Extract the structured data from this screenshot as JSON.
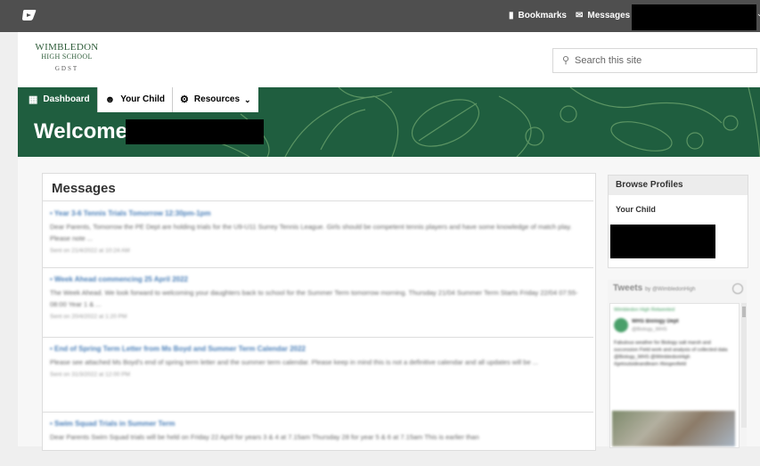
{
  "topbar": {
    "bookmarks_label": "Bookmarks",
    "messages_label": "Messages"
  },
  "school": {
    "logo_line1": "WIMBLEDON",
    "logo_line2": "HIGH SCHOOL",
    "logo_line3": "GDST"
  },
  "search": {
    "placeholder": "Search this site"
  },
  "nav": {
    "items": [
      {
        "label": "Dashboard"
      },
      {
        "label": "Your Child"
      },
      {
        "label": "Resources"
      }
    ]
  },
  "hero": {
    "welcome": "Welcome,"
  },
  "messages": {
    "title": "Messages",
    "items": [
      {
        "title": "• Year 3-6 Tennis Trials Tomorrow 12:30pm-1pm",
        "body": "Dear Parents, Tomorrow the PE Dept are holding trials for the U9-U11 Surrey Tennis League. Girls should be competent tennis players and have some knowledge of match play. Please note ...",
        "date": "Sent on 21/4/2022 at 10:24 AM"
      },
      {
        "title": "• Week Ahead commencing 25 April 2022",
        "body": "The Week Ahead. We look forward to welcoming your daughters back to school for the Summer Term tomorrow morning. Thursday 21/04 Summer Term Starts Friday 22/04 07:55-08:00 Year 1 & ...",
        "date": "Sent on 20/4/2022 at 1:20 PM"
      },
      {
        "title": "• End of Spring Term Letter from Ms Boyd and Summer Term Calendar 2022",
        "body": "Please see attached Ms Boyd's end of spring term letter and the summer term calendar. Please keep in mind this is not a definitive calendar and all updates will be ...",
        "date": "Sent on 31/3/2022 at 12:00 PM"
      },
      {
        "title": "• Swim Squad Trials in Summer Term",
        "body": "Dear Parents Swim Squad trials will be held on Friday 22 April for years 3 & 4 at 7.15am Thursday 28 for year 5 & 6 at 7.15am This is earlier than",
        "date": ""
      }
    ]
  },
  "browse_profiles": {
    "title": "Browse Profiles",
    "your_child": "Your Child"
  },
  "tweets": {
    "title": "Tweets",
    "by": "by @WimbledonHigh",
    "account_line": "Wimbledon High Retweeted",
    "author": "WHS Biology Dept",
    "handle": "@Biology_WHS",
    "text": "Fabulous weather for Biology salt marsh and succession Field work and analysis of collected data @Biology_WHS @WimbledonHigh #getoutsideandlearn #biogeofield"
  }
}
